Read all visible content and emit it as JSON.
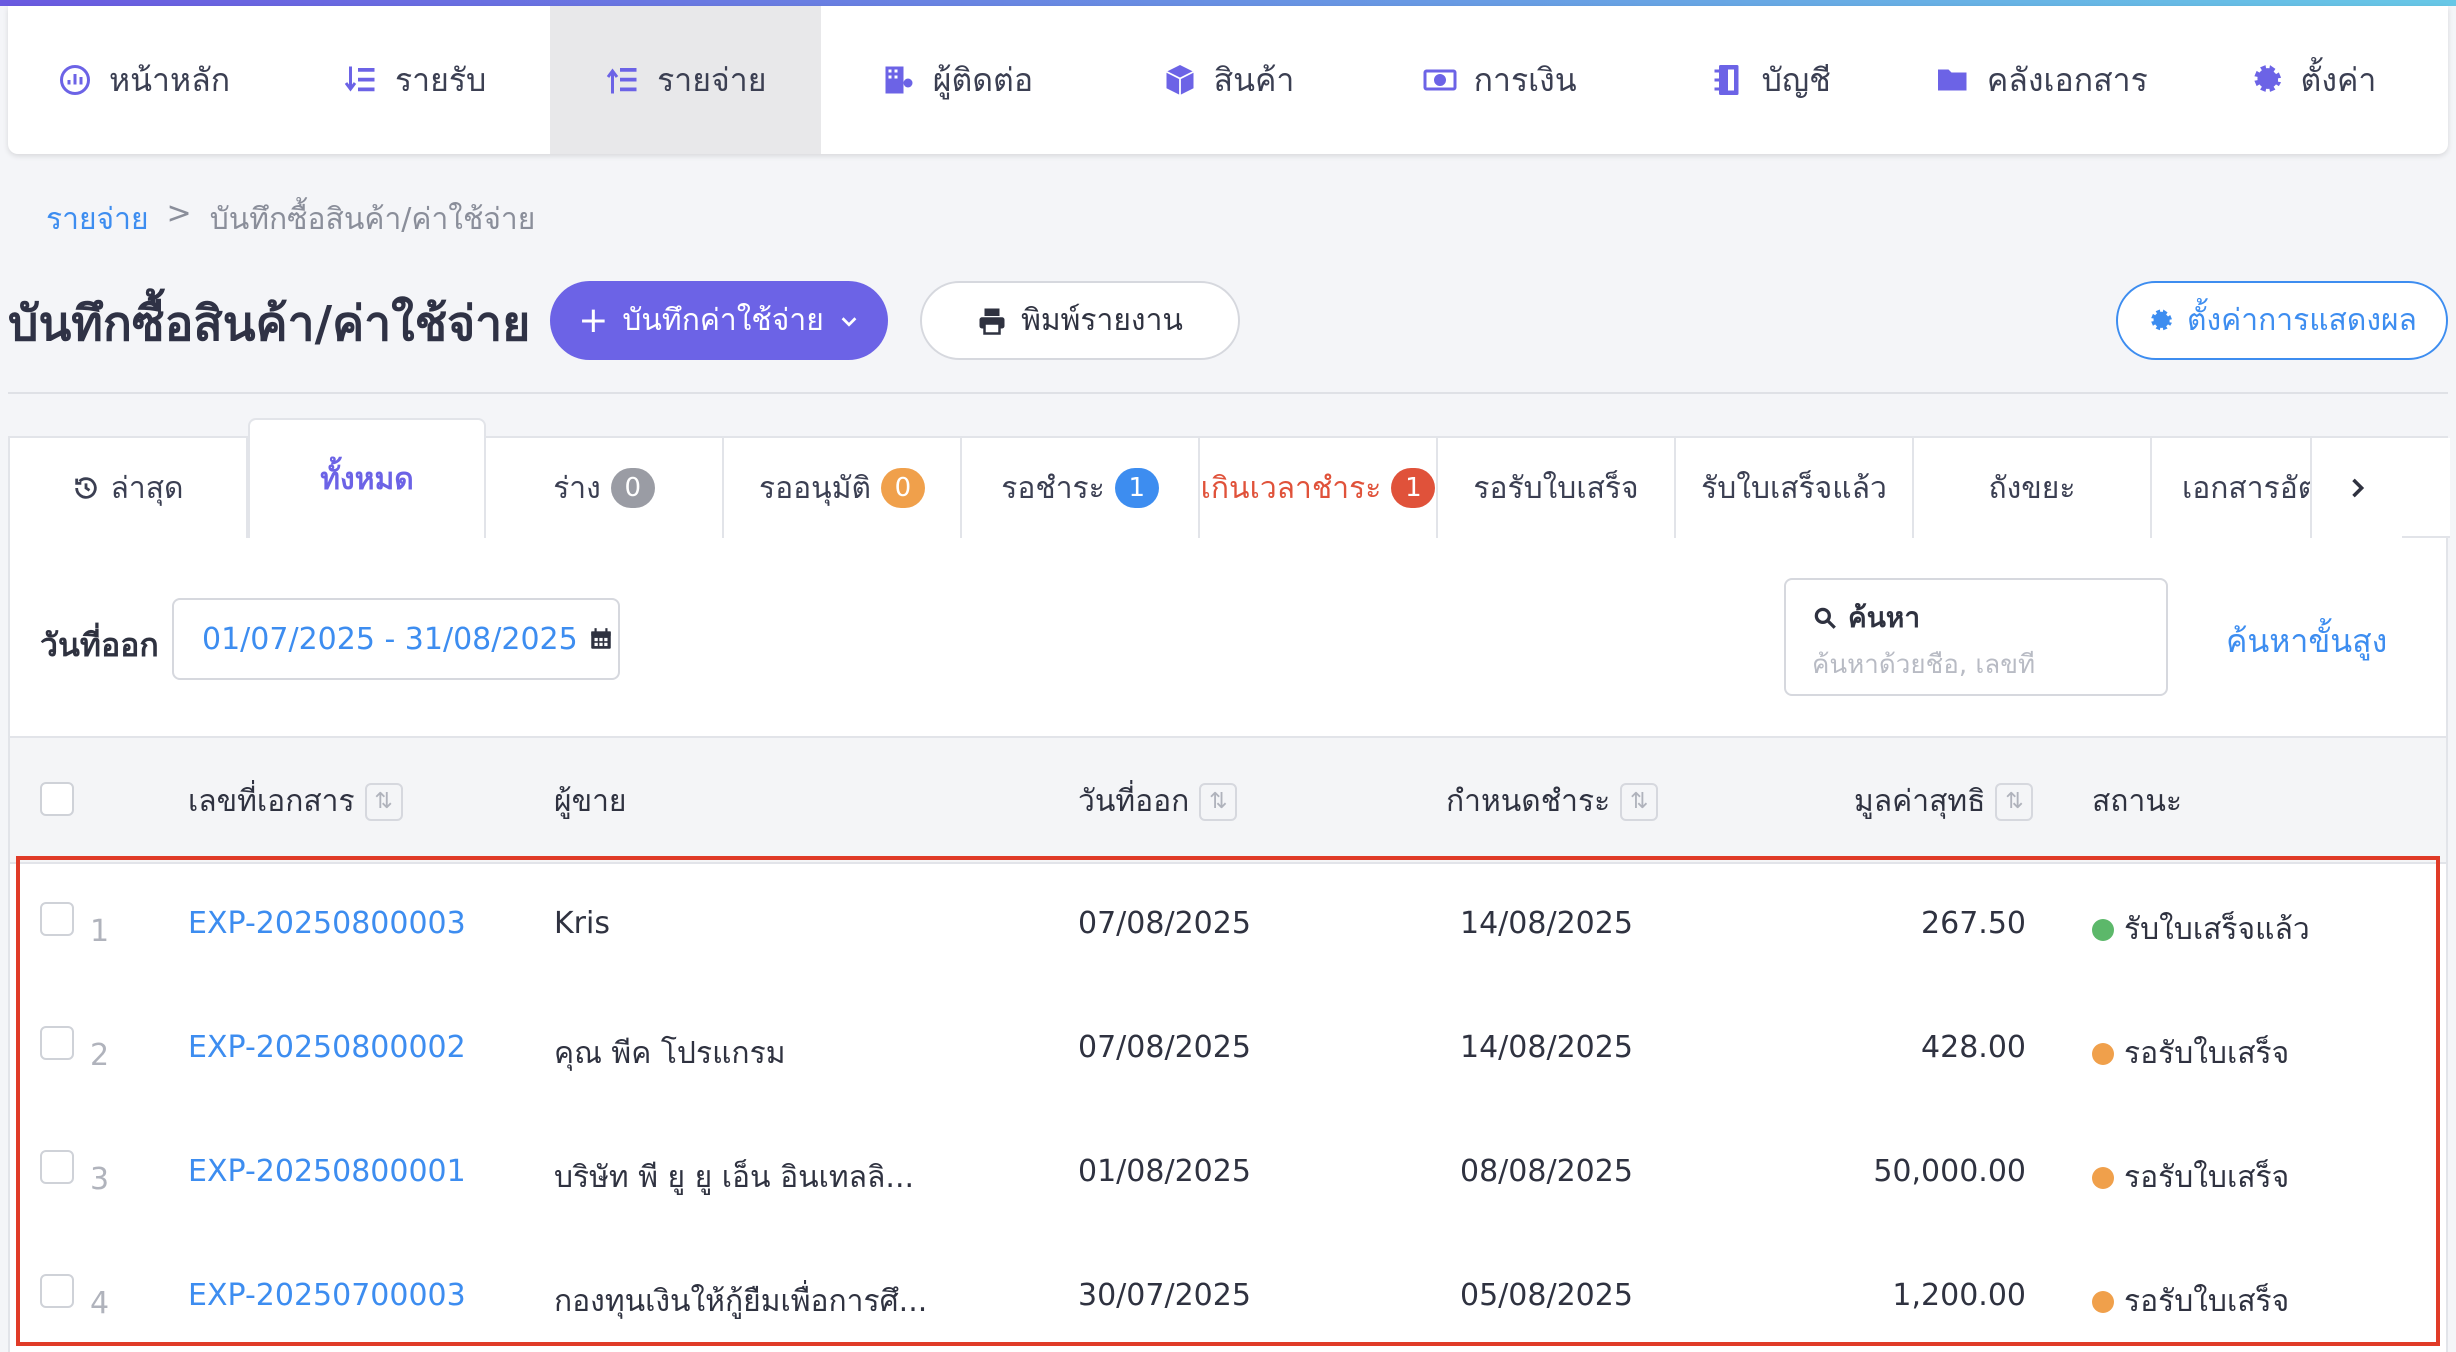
{
  "colors": {
    "accent": "#6c63e6",
    "link": "#3d8df0",
    "overdue": "#e0523a",
    "paid": "#5cb86a",
    "pending": "#f0a04b",
    "highlight": "#e03b27"
  },
  "nav": {
    "items": [
      {
        "label": "หน้าหลัก",
        "icon": "dashboard-icon"
      },
      {
        "label": "รายรับ",
        "icon": "income-list-icon"
      },
      {
        "label": "รายจ่าย",
        "icon": "expense-list-icon"
      },
      {
        "label": "ผู้ติดต่อ",
        "icon": "contacts-building-icon"
      },
      {
        "label": "สินค้า",
        "icon": "box-icon"
      },
      {
        "label": "การเงิน",
        "icon": "money-icon"
      },
      {
        "label": "บัญชี",
        "icon": "book-icon"
      },
      {
        "label": "คลังเอกสาร",
        "icon": "folder-icon"
      },
      {
        "label": "ตั้งค่า",
        "icon": "gear-icon"
      }
    ],
    "active_index": 2
  },
  "breadcrumb": {
    "parent": "รายจ่าย",
    "separator": ">",
    "current": "บันทึกซื้อสินค้า/ค่าใช้จ่าย"
  },
  "page": {
    "title": "บันทึกซื้อสินค้า/ค่าใช้จ่าย",
    "add_button": "บันทึกค่าใช้จ่าย",
    "print_button": "พิมพ์รายงาน",
    "display_settings_button": "ตั้งค่าการแสดงผล"
  },
  "tabs": [
    {
      "label": "ล่าสุด",
      "icon": "history-icon"
    },
    {
      "label": "ทั้งหมด",
      "active": true
    },
    {
      "label": "ร่าง",
      "badge": "0",
      "badge_color": "#9a9ca4"
    },
    {
      "label": "รออนุมัติ",
      "badge": "0",
      "badge_color": "#f0a04b"
    },
    {
      "label": "รอชำระ",
      "badge": "1",
      "badge_color": "#3d8df0"
    },
    {
      "label": "เกินเวลาชำระ",
      "badge": "1",
      "badge_color": "#e0523a",
      "overdue": true
    },
    {
      "label": "รอรับใบเสร็จ"
    },
    {
      "label": "รับใบเสร็จแล้ว"
    },
    {
      "label": "ถังขยะ"
    },
    {
      "label": "เอกสารอัตโน"
    }
  ],
  "filters": {
    "date_label": "วันที่ออก",
    "date_range": "01/07/2025 - 31/08/2025",
    "search_title": "ค้นหา",
    "search_placeholder": "ค้นหาด้วยชื่อ, เลขที่",
    "advanced_search": "ค้นหาขั้นสูง"
  },
  "table": {
    "headers": {
      "doc_no": "เลขที่เอกสาร",
      "vendor": "ผู้ขาย",
      "issue_date": "วันที่ออก",
      "due_date": "กำหนดชำระ",
      "net_amount": "มูลค่าสุทธิ",
      "status": "สถานะ"
    },
    "rows": [
      {
        "no": "1",
        "doc_no": "EXP-20250800003",
        "vendor": "Kris",
        "issue_date": "07/08/2025",
        "due_date": "14/08/2025",
        "net_amount": "267.50",
        "status": "รับใบเสร็จแล้ว",
        "status_color": "#5cb86a"
      },
      {
        "no": "2",
        "doc_no": "EXP-20250800002",
        "vendor": "คุณ พีค โปรแกรม",
        "issue_date": "07/08/2025",
        "due_date": "14/08/2025",
        "net_amount": "428.00",
        "status": "รอรับใบเสร็จ",
        "status_color": "#f0a04b"
      },
      {
        "no": "3",
        "doc_no": "EXP-20250800001",
        "vendor": "บริษัท พี ยู ยู เอ็น อินเทลลิ...",
        "issue_date": "01/08/2025",
        "due_date": "08/08/2025",
        "net_amount": "50,000.00",
        "status": "รอรับใบเสร็จ",
        "status_color": "#f0a04b"
      },
      {
        "no": "4",
        "doc_no": "EXP-20250700003",
        "vendor": "กองทุนเงินให้กู้ยืมเพื่อการศึ...",
        "issue_date": "30/07/2025",
        "due_date": "05/08/2025",
        "net_amount": "1,200.00",
        "status": "รอรับใบเสร็จ",
        "status_color": "#f0a04b"
      }
    ]
  }
}
